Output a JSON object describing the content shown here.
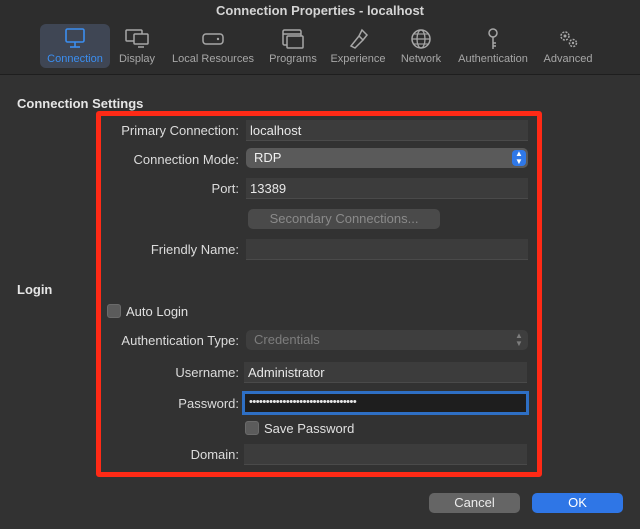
{
  "window": {
    "title": "Connection Properties - localhost"
  },
  "toolbar": {
    "items": [
      {
        "label": "Connection",
        "icon": "monitor-icon",
        "active": true
      },
      {
        "label": "Display",
        "icon": "displays-icon"
      },
      {
        "label": "Local Resources",
        "icon": "drive-icon"
      },
      {
        "label": "Programs",
        "icon": "programs-window-icon"
      },
      {
        "label": "Experience",
        "icon": "experience-icon"
      },
      {
        "label": "Network",
        "icon": "globe-icon"
      },
      {
        "label": "Authentication",
        "icon": "key-icon"
      },
      {
        "label": "Advanced",
        "icon": "gears-icon"
      }
    ],
    "accent": "#3b8ef0"
  },
  "connection": {
    "section_title": "Connection Settings",
    "primary_label": "Primary Connection:",
    "primary_value": "localhost",
    "mode_label": "Connection Mode:",
    "mode_value": "RDP",
    "port_label": "Port:",
    "port_value": "13389",
    "secondary_button": "Secondary Connections...",
    "friendly_label": "Friendly Name:",
    "friendly_value": ""
  },
  "login": {
    "section_title": "Login",
    "auto_login_label": "Auto Login",
    "auto_login_checked": false,
    "auth_type_label": "Authentication Type:",
    "auth_type_value": "Credentials",
    "username_label": "Username:",
    "username_value": "Administrator",
    "password_label": "Password:",
    "password_value": "••••••••••••••••••••••••••••••••",
    "save_password_label": "Save Password",
    "save_password_checked": false,
    "domain_label": "Domain:",
    "domain_value": ""
  },
  "footer": {
    "cancel_label": "Cancel",
    "ok_label": "OK"
  },
  "colors": {
    "highlight_box": "#ff2a16",
    "ok_button": "#2f76e6"
  }
}
